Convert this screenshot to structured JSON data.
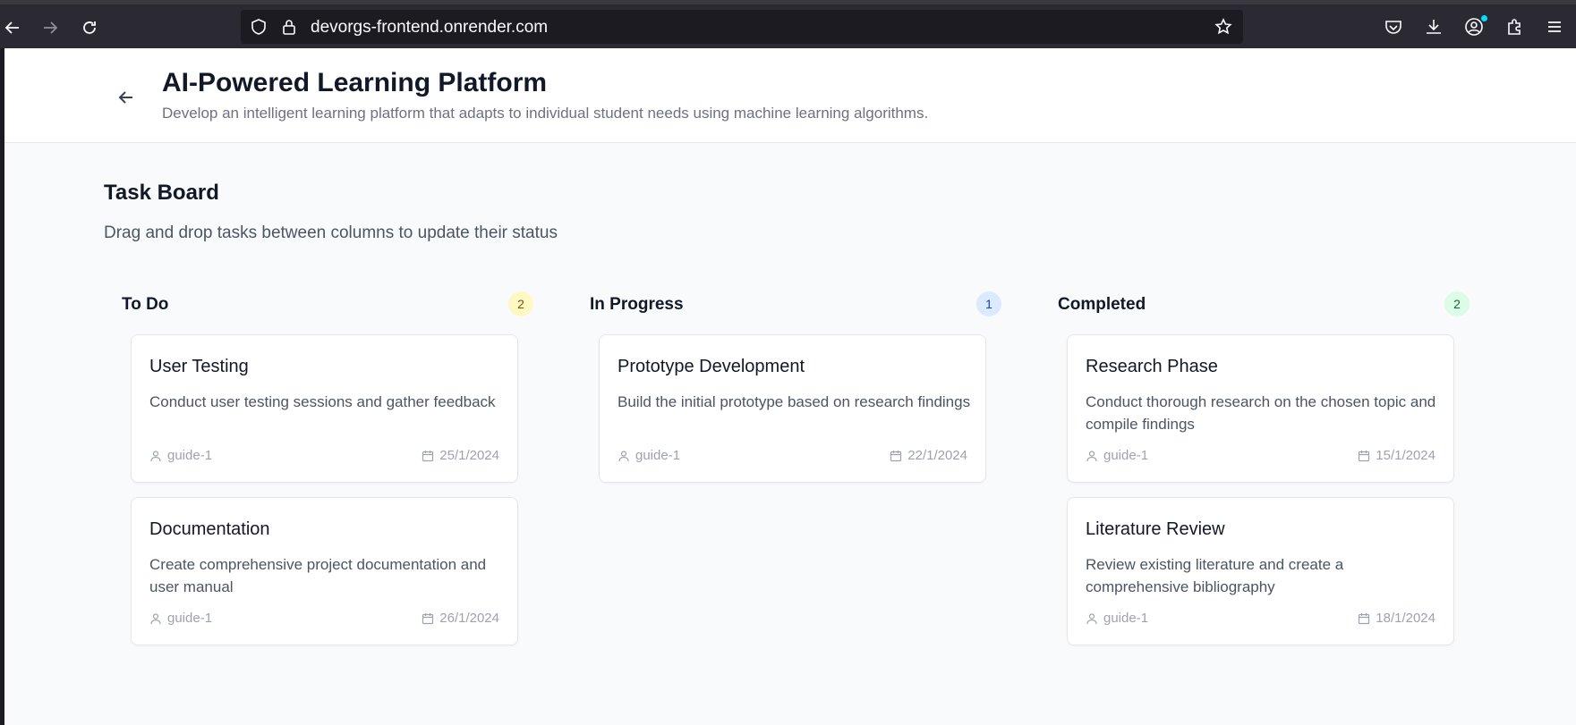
{
  "browser": {
    "url": "devorgs-frontend.onrender.com"
  },
  "header": {
    "title": "AI-Powered Learning Platform",
    "subtitle": "Develop an intelligent learning platform that adapts to individual student needs using machine learning algorithms."
  },
  "board": {
    "title": "Task Board",
    "subtitle": "Drag and drop tasks between columns to update their status"
  },
  "columns": [
    {
      "title": "To Do",
      "count": "2",
      "cards": [
        {
          "title": "User Testing",
          "description": "Conduct user testing sessions and gather feedback",
          "assignee": "guide-1",
          "due": "25/1/2024"
        },
        {
          "title": "Documentation",
          "description": "Create comprehensive project documentation and user manual",
          "assignee": "guide-1",
          "due": "26/1/2024"
        }
      ]
    },
    {
      "title": "In Progress",
      "count": "1",
      "cards": [
        {
          "title": "Prototype Development",
          "description": "Build the initial prototype based on research findings",
          "assignee": "guide-1",
          "due": "22/1/2024"
        }
      ]
    },
    {
      "title": "Completed",
      "count": "2",
      "cards": [
        {
          "title": "Research Phase",
          "description": "Conduct thorough research on the chosen topic and compile findings",
          "assignee": "guide-1",
          "due": "15/1/2024"
        },
        {
          "title": "Literature Review",
          "description": "Review existing literature and create a comprehensive bibliography",
          "assignee": "guide-1",
          "due": "18/1/2024"
        }
      ]
    }
  ]
}
